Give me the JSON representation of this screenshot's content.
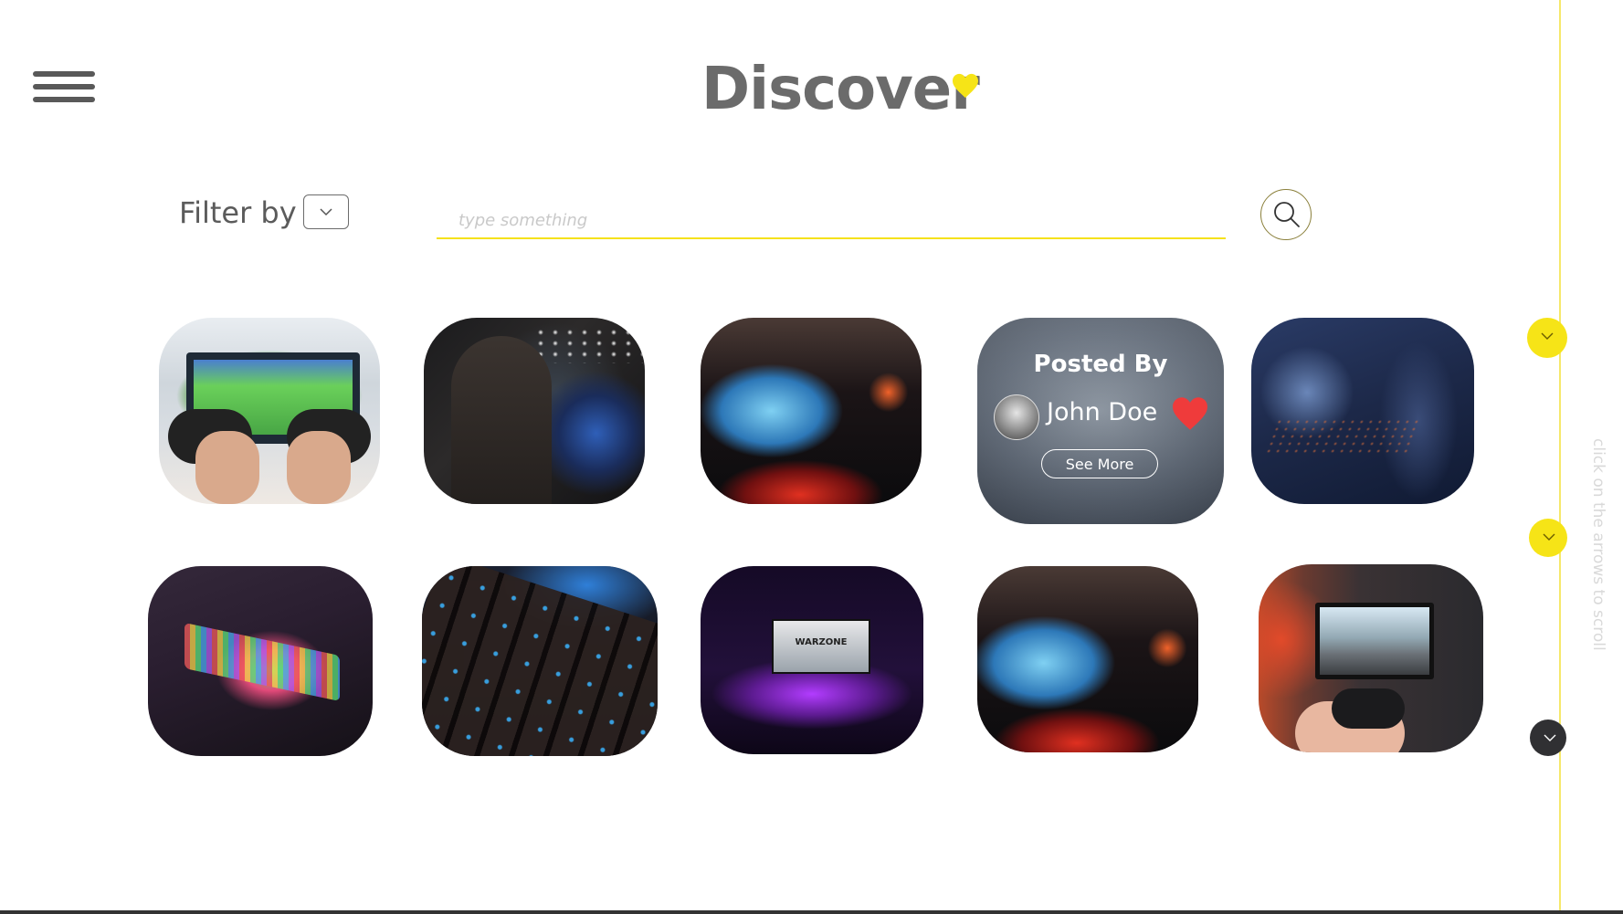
{
  "header": {
    "title": "Discover"
  },
  "filter": {
    "label": "Filter by"
  },
  "search": {
    "placeholder": "type something",
    "value": ""
  },
  "featured_card": {
    "posted_by_label": "Posted By",
    "author": "John Doe",
    "see_more_label": "See More"
  },
  "grid": {
    "warzone_screen_text": "WARZONE"
  },
  "scroll": {
    "hint": "click on the arrows to scroll"
  },
  "colors": {
    "accent_yellow": "#f6e417",
    "like_red": "#ef3b3b",
    "title_gray": "#6b6b6b"
  },
  "icons": {
    "menu": "hamburger-menu-icon",
    "title_heart": "heart-icon",
    "filter_dropdown": "chevron-down-icon",
    "search": "search-icon",
    "like": "heart-icon",
    "scroll_arrows": "chevron-down-icon"
  }
}
